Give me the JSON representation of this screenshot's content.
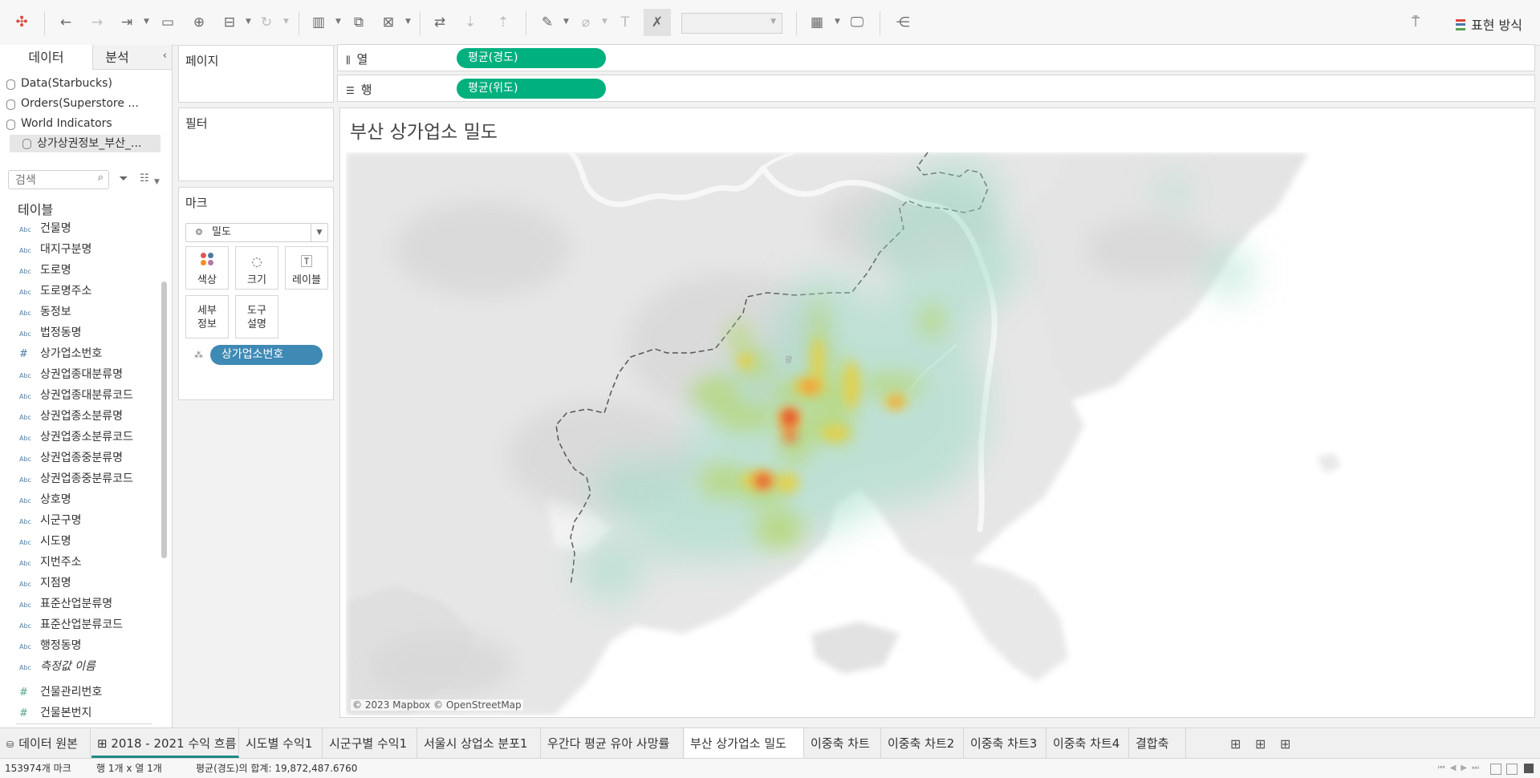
{
  "app": {
    "accent": "#00b07f",
    "pill_blue": "#3f8ab5"
  },
  "toolbar": {
    "icons": [
      "tableau-logo-icon",
      "undo-icon",
      "redo-icon",
      "replay-icon",
      "save-icon",
      "new-datasource-icon",
      "pause-updates-icon",
      "refresh-icon",
      "new-worksheet-icon",
      "duplicate-sheet-icon",
      "clear-sheet-icon",
      "swap-icon",
      "sort-ascending-icon",
      "sort-descending-icon",
      "highlight-icon",
      "group-icon",
      "labels-icon",
      "fix-axes-icon",
      "fit-select-icon",
      "show-cards-icon",
      "presentation-icon",
      "share-icon",
      "format-brush-icon"
    ],
    "show_me_label": "표현 방식"
  },
  "left": {
    "tabs": [
      "데이터",
      "분석"
    ],
    "datasources": [
      "Data(Starbucks)",
      "Orders(Superstore ...",
      "World Indicators",
      "상가상권정보_부산_..."
    ],
    "search_placeholder": "검색",
    "tables_header": "테이블",
    "fields": [
      {
        "type": "Abc",
        "name": "건물명"
      },
      {
        "type": "Abc",
        "name": "대지구분명"
      },
      {
        "type": "Abc",
        "name": "도로명"
      },
      {
        "type": "Abc",
        "name": "도로명주소"
      },
      {
        "type": "Abc",
        "name": "동정보"
      },
      {
        "type": "Abc",
        "name": "법정동명"
      },
      {
        "type": "#",
        "name": "상가업소번호"
      },
      {
        "type": "Abc",
        "name": "상권업종대분류명"
      },
      {
        "type": "Abc",
        "name": "상권업종대분류코드"
      },
      {
        "type": "Abc",
        "name": "상권업종소분류명"
      },
      {
        "type": "Abc",
        "name": "상권업종소분류코드"
      },
      {
        "type": "Abc",
        "name": "상권업종중분류명"
      },
      {
        "type": "Abc",
        "name": "상권업종중분류코드"
      },
      {
        "type": "Abc",
        "name": "상호명"
      },
      {
        "type": "Abc",
        "name": "시군구명"
      },
      {
        "type": "Abc",
        "name": "시도명"
      },
      {
        "type": "Abc",
        "name": "지번주소"
      },
      {
        "type": "Abc",
        "name": "지점명"
      },
      {
        "type": "Abc",
        "name": "표준산업분류명"
      },
      {
        "type": "Abc",
        "name": "표준산업분류코드"
      },
      {
        "type": "Abc",
        "name": "행정동명"
      },
      {
        "type": "Abc",
        "name": "측정값 이름"
      },
      {
        "type": "#",
        "name": "건물관리번호"
      },
      {
        "type": "#",
        "name": "건물본번지"
      }
    ]
  },
  "cards": {
    "pages": "페이지",
    "filters": "필터",
    "marks": "마크",
    "mark_type": "밀도",
    "buttons": {
      "color": "색상",
      "size": "크기",
      "label": "레이블",
      "detail_1": "세부",
      "detail_2": "정보",
      "tooltip_1": "도구",
      "tooltip_2": "설명"
    },
    "detail_pill": "상가업소번호"
  },
  "shelves": {
    "columns_label": "열",
    "rows_label": "행",
    "columns_pill": "평균(경도)",
    "rows_pill": "평균(위도)"
  },
  "view": {
    "title": "부산 상가업소 밀도",
    "attribution": "© 2023 Mapbox © OpenStreetMap",
    "map_label": "광"
  },
  "sheet_tabs": {
    "datasource": "데이터 원본",
    "tabs": [
      "2018 - 2021 수익 흐름",
      "시도별 수익1",
      "시군구별 수익1",
      "서울시 상업소 분포1",
      "우간다 평균 유아 사망률",
      "부산 상가업소 밀도",
      "이중축 차트",
      "이중축 차트2",
      "이중축 차트3",
      "이중축 차트4",
      "결합축"
    ],
    "active_index": 5
  },
  "status": {
    "marks": "153974개 마크",
    "dims": "행 1개 x 열 1개",
    "sum": "평균(경도)의 합계: 19,872,487.6760"
  }
}
